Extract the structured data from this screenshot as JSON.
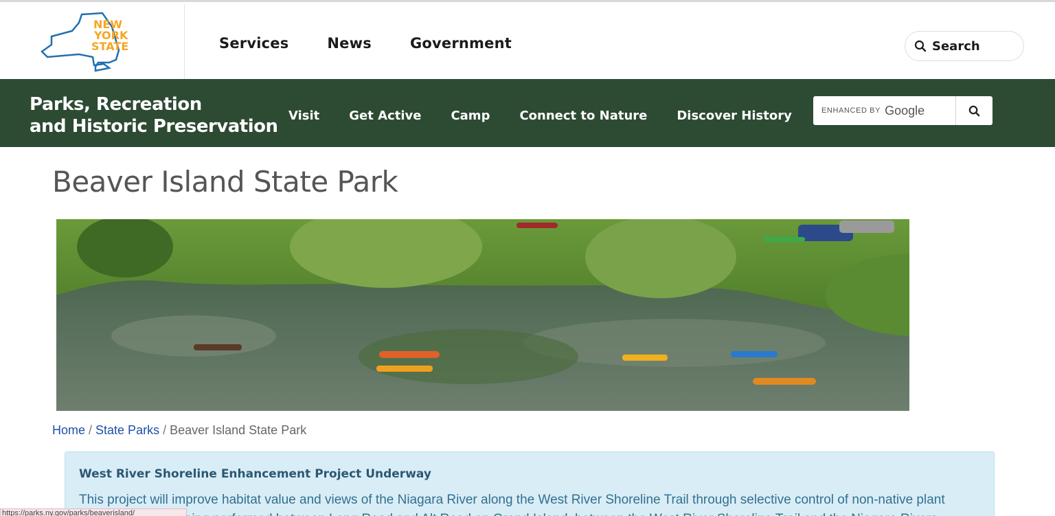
{
  "nys_header": {
    "logo_text": [
      "NEW",
      "YORK",
      "STATE"
    ],
    "nav": [
      {
        "label": "Services"
      },
      {
        "label": "News"
      },
      {
        "label": "Government"
      }
    ],
    "search_label": "Search"
  },
  "agency_header": {
    "title_line1": "Parks, Recreation",
    "title_line2": "and Historic Preservation",
    "nav": [
      {
        "label": "Visit"
      },
      {
        "label": "Get Active"
      },
      {
        "label": "Camp"
      },
      {
        "label": "Connect to Nature"
      },
      {
        "label": "Discover History"
      }
    ],
    "search": {
      "enhanced_by": "ENHANCED BY",
      "brand": "Google"
    }
  },
  "main": {
    "page_title": "Beaver Island State Park",
    "breadcrumb": [
      {
        "label": "Home"
      },
      {
        "label": "State Parks"
      },
      {
        "label": "Beaver Island State Park"
      }
    ],
    "alert": {
      "title": "West River Shoreline Enhancement Project Underway",
      "body": "This project will improve habitat value and views of the Niagara River along the West River Shoreline Trail through selective control of non-native plant species. Work is being performed between Long Road and Alt Road on Grand Island, between the West River Shoreline Trail and the Niagara Rivers."
    }
  },
  "status_bar": {
    "url": "https://parks.ny.gov/parks/beaverisland/"
  },
  "colors": {
    "agency_green": "#2d4a33",
    "nys_gold": "#f5a623",
    "nys_blue": "#1f6fb2",
    "link_blue": "#1d4fa8",
    "alert_bg": "#d9edf7"
  }
}
